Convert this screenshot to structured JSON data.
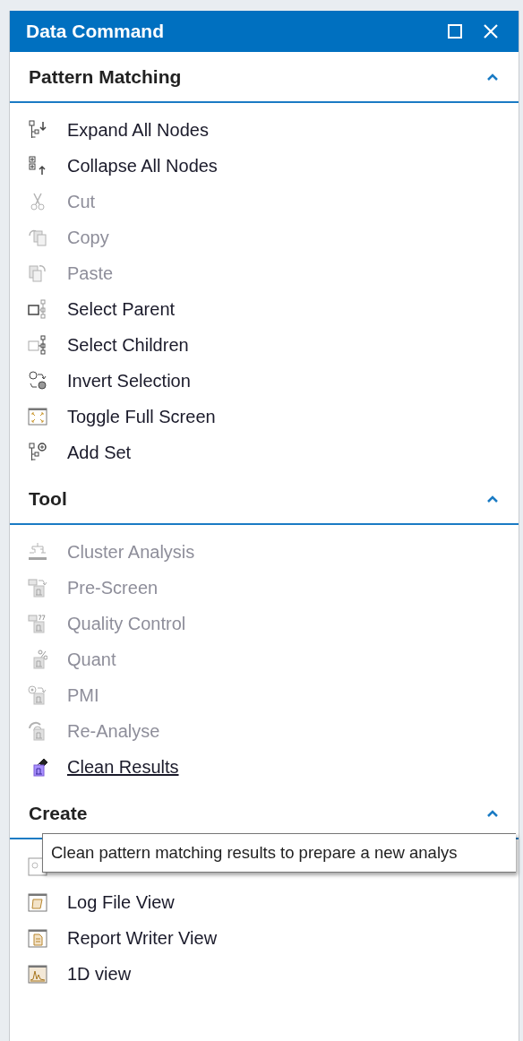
{
  "window": {
    "title": "Data Command"
  },
  "sections": [
    {
      "title": "Pattern Matching",
      "expanded": true,
      "items": [
        {
          "label": "Expand All Nodes",
          "disabled": false,
          "hovered": false
        },
        {
          "label": "Collapse All Nodes",
          "disabled": false,
          "hovered": false
        },
        {
          "label": "Cut",
          "disabled": true,
          "hovered": false
        },
        {
          "label": "Copy",
          "disabled": true,
          "hovered": false
        },
        {
          "label": "Paste",
          "disabled": true,
          "hovered": false
        },
        {
          "label": "Select Parent",
          "disabled": false,
          "hovered": false
        },
        {
          "label": "Select Children",
          "disabled": false,
          "hovered": false
        },
        {
          "label": "Invert Selection",
          "disabled": false,
          "hovered": false
        },
        {
          "label": "Toggle Full Screen",
          "disabled": false,
          "hovered": false
        },
        {
          "label": "Add Set",
          "disabled": false,
          "hovered": false
        }
      ]
    },
    {
      "title": "Tool",
      "expanded": true,
      "items": [
        {
          "label": "Cluster Analysis",
          "disabled": true,
          "hovered": false
        },
        {
          "label": "Pre-Screen",
          "disabled": true,
          "hovered": false
        },
        {
          "label": "Quality Control",
          "disabled": true,
          "hovered": false
        },
        {
          "label": "Quant",
          "disabled": true,
          "hovered": false
        },
        {
          "label": "PMI",
          "disabled": true,
          "hovered": false
        },
        {
          "label": "Re-Analyse",
          "disabled": true,
          "hovered": false
        },
        {
          "label": "Clean Results",
          "disabled": false,
          "hovered": true
        }
      ]
    },
    {
      "title": "Create",
      "expanded": true,
      "items": [
        {
          "disabled": false
        },
        {
          "label": "Log File View",
          "disabled": false,
          "hovered": false
        },
        {
          "label": "Report Writer View",
          "disabled": false,
          "hovered": false
        },
        {
          "label": "1D view",
          "disabled": false,
          "hovered": false
        }
      ]
    }
  ],
  "tooltip": {
    "text": "Clean pattern matching results to prepare a new analys"
  }
}
